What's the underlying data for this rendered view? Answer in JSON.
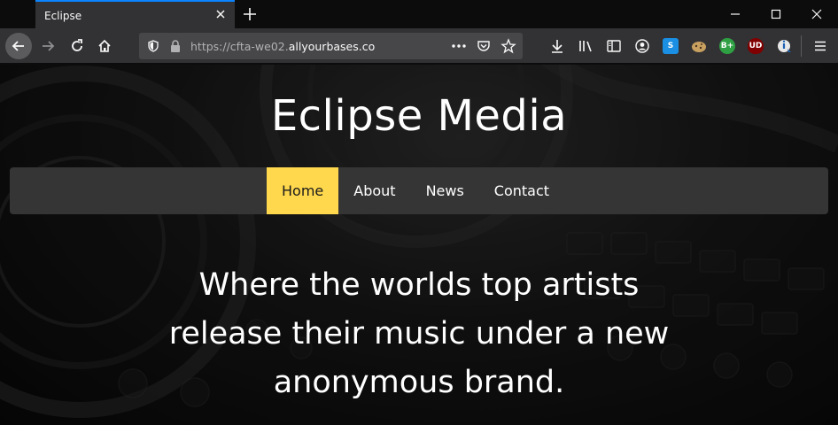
{
  "browser": {
    "tab_title": "Eclipse",
    "url_prefix": "https://cfta-we02.",
    "url_host": "allyourbases.co",
    "extensions": [
      {
        "name": "s-extension-icon",
        "label": "S",
        "color": "#1a8fe3"
      },
      {
        "name": "b-plus-extension-icon",
        "label": "B+",
        "color": "#2ea043"
      },
      {
        "name": "ublock-origin-icon",
        "label": "UD",
        "color": "#800000"
      }
    ]
  },
  "site": {
    "title": "Eclipse Media",
    "nav": [
      {
        "label": "Home",
        "active": true
      },
      {
        "label": "About",
        "active": false
      },
      {
        "label": "News",
        "active": false
      },
      {
        "label": "Contact",
        "active": false
      }
    ],
    "tagline": "Where the worlds top artists release their music under a new anonymous brand.",
    "accent_color": "#ffd84d"
  }
}
